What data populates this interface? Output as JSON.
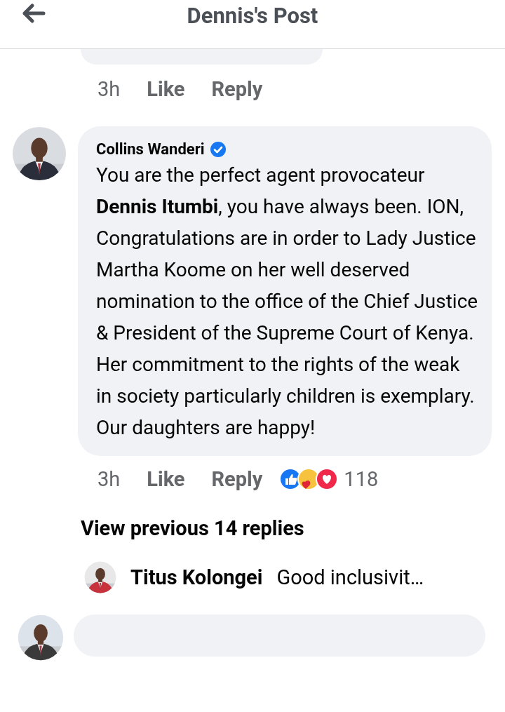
{
  "header": {
    "title": "Dennis's Post"
  },
  "previous_comment": {
    "time": "3h",
    "actions": [
      "Like",
      "Reply"
    ]
  },
  "comment": {
    "author": "Collins Wanderi",
    "verified": true,
    "body": "You are the perfect agent provocateur **Dennis Itumbi**, you have always been. ION, Congratulations are in order to Lady Justice Martha Koome on her well deserved nomination to the office of the Chief Justice & President of the Supreme Court of Kenya. Her commitment to the rights of the weak in society particularly children is exemplary. Our daughters are happy!",
    "time": "3h",
    "actions": [
      "Like",
      "Reply"
    ],
    "reaction_count": "118"
  },
  "view_previous": "View previous 14 replies",
  "reply": {
    "author": "Titus Kolongei",
    "text": "Good inclusivit…"
  }
}
